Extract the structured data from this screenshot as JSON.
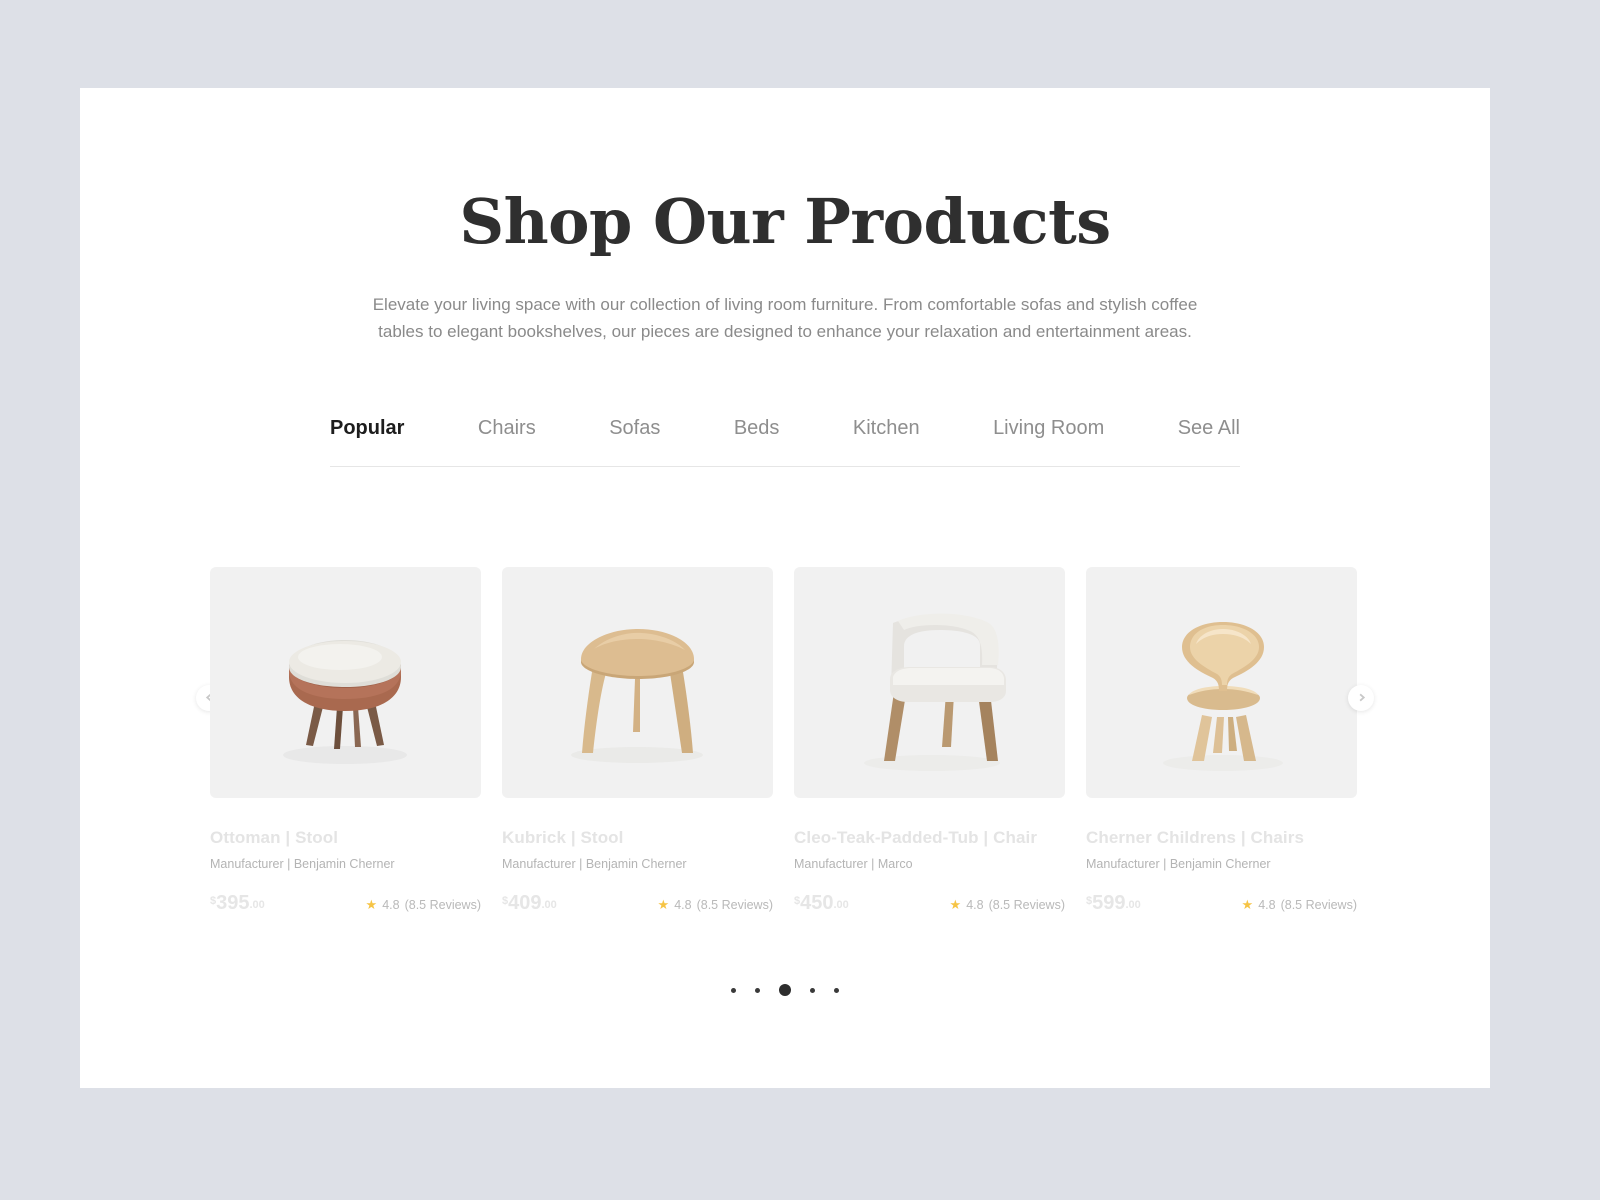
{
  "theme": {
    "page_background": "#dde0e7",
    "panel_background": "#ffffff",
    "accent_star": "#f6c445",
    "title_color": "#2f2f2f",
    "muted_text": "#8a8a8a"
  },
  "header": {
    "title": "Shop Our Products",
    "subtitle": "Elevate your living space with our collection of living room furniture. From comfortable sofas and stylish coffee tables to elegant bookshelves, our pieces are designed to enhance your relaxation and entertainment areas."
  },
  "tabs": [
    {
      "label": "Popular",
      "active": true
    },
    {
      "label": "Chairs",
      "active": false
    },
    {
      "label": "Sofas",
      "active": false
    },
    {
      "label": "Beds",
      "active": false
    },
    {
      "label": "Kitchen",
      "active": false
    },
    {
      "label": "Living Room",
      "active": false
    },
    {
      "label": "See All",
      "active": false
    }
  ],
  "carousel": {
    "prev_icon": "chevron-left-icon",
    "next_icon": "chevron-right-icon",
    "dots": {
      "count": 5,
      "active_index": 2
    }
  },
  "products": [
    {
      "title": "Ottoman | Stool",
      "manufacturer": "Manufacturer | Benjamin Cherner",
      "currency": "$",
      "price": "395",
      "cents": ".00",
      "rating": "4.8",
      "reviews": "(8.5 Reviews)",
      "star_icon": "star-icon",
      "image_alt": "round upholstered ottoman stool"
    },
    {
      "title": "Kubrick | Stool",
      "manufacturer": "Manufacturer | Benjamin Cherner",
      "currency": "$",
      "price": "409",
      "cents": ".00",
      "rating": "4.8",
      "reviews": "(8.5 Reviews)",
      "star_icon": "star-icon",
      "image_alt": "light oak three legged table"
    },
    {
      "title": "Cleo-Teak-Padded-Tub | Chair",
      "manufacturer": "Manufacturer | Marco",
      "currency": "$",
      "price": "450",
      "cents": ".00",
      "rating": "4.8",
      "reviews": "(8.5 Reviews)",
      "star_icon": "star-icon",
      "image_alt": "white upholstered tub chair with wooden legs"
    },
    {
      "title": "Cherner Childrens | Chairs",
      "manufacturer": "Manufacturer | Benjamin Cherner",
      "currency": "$",
      "price": "599",
      "cents": ".00",
      "rating": "4.8",
      "reviews": "(8.5 Reviews)",
      "star_icon": "star-icon",
      "image_alt": "bentwood cherner childrens chair"
    }
  ]
}
